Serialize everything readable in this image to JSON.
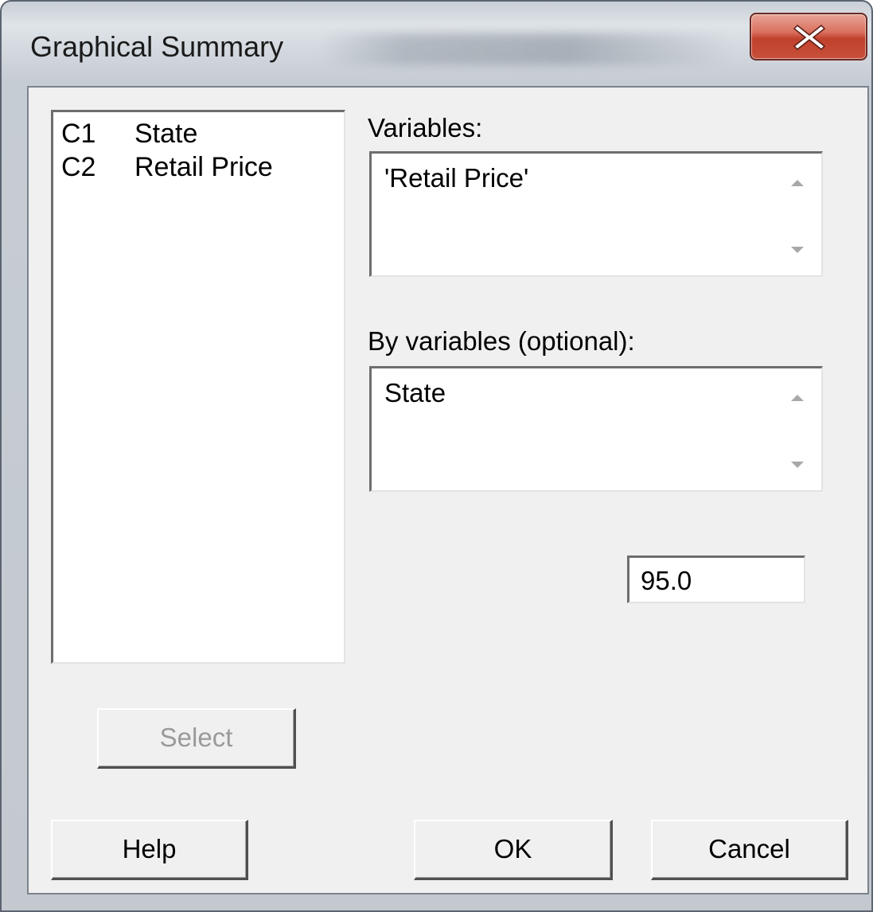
{
  "window": {
    "title": "Graphical Summary"
  },
  "columns_list": {
    "items": [
      {
        "col": "C1",
        "name": "State"
      },
      {
        "col": "C2",
        "name": "Retail Price"
      }
    ]
  },
  "variables": {
    "label": "Variables:",
    "value": "'Retail Price'"
  },
  "by_variables": {
    "label": "By variables (optional):",
    "value": "State"
  },
  "confidence_level": {
    "value": "95.0"
  },
  "buttons": {
    "select": "Select",
    "help": "Help",
    "ok": "OK",
    "cancel": "Cancel"
  },
  "icons": {
    "close": "close-icon",
    "scroll_up": "scroll-up-arrow-icon",
    "scroll_down": "scroll-down-arrow-icon"
  },
  "colors": {
    "close_button": "#c8503a",
    "dialog_background": "#f0f0f0",
    "disabled_text": "#9a9a9a"
  }
}
